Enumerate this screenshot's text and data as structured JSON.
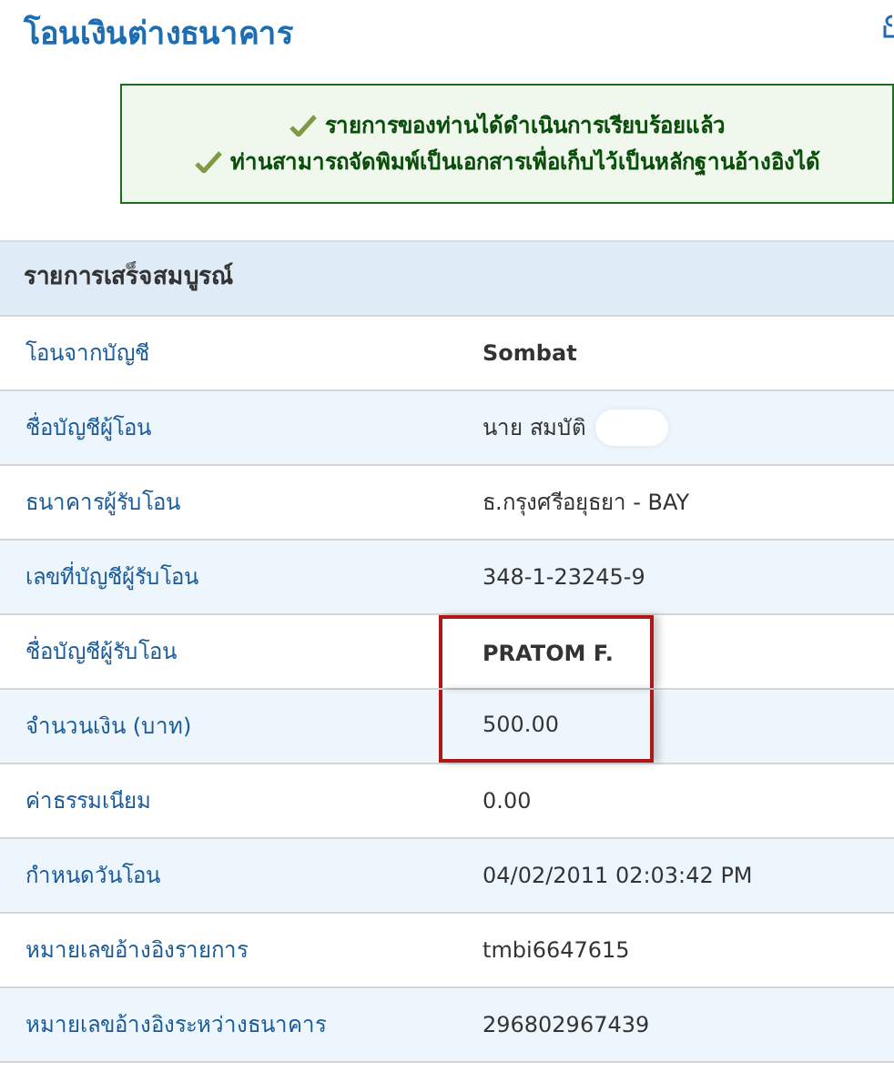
{
  "title": "โอนเงินต่างธนาคาร",
  "notice": [
    "รายการของท่านได้ดำเนินการเรียบร้อยแล้ว",
    "ท่านสามารถจัดพิมพ์เป็นเอกสารเพื่อเก็บไว้เป็นหลักฐานอ้างอิงได้"
  ],
  "section": {
    "title": "รายการเสร็จสมบูรณ์"
  },
  "rows": [
    {
      "label": "โอนจากบัญชี",
      "value": "Sombat",
      "emphasis": true,
      "redacted": false,
      "highlighted": false
    },
    {
      "label": "ชื่อบัญชีผู้โอน",
      "value": "นาย สมบัติ",
      "emphasis": false,
      "redacted": true,
      "highlighted": false
    },
    {
      "label": "ธนาคารผู้รับโอน",
      "value": "ธ.กรุงศรีอยุธยา - BAY",
      "emphasis": false,
      "redacted": false,
      "highlighted": false
    },
    {
      "label": "เลขที่บัญชีผู้รับโอน",
      "value": "348-1-23245-9",
      "emphasis": false,
      "redacted": false,
      "highlighted": false
    },
    {
      "label": "ชื่อบัญชีผู้รับโอน",
      "value": "PRATOM F.",
      "emphasis": true,
      "redacted": false,
      "highlighted": true
    },
    {
      "label": "จำนวนเงิน (บาท)",
      "value": "500.00",
      "emphasis": false,
      "redacted": false,
      "highlighted": true
    },
    {
      "label": "ค่าธรรมเนียม",
      "value": "0.00",
      "emphasis": false,
      "redacted": false,
      "highlighted": false
    },
    {
      "label": "กำหนดวันโอน",
      "value": "04/02/2011 02:03:42 PM",
      "emphasis": false,
      "redacted": false,
      "highlighted": false
    },
    {
      "label": "หมายเลขอ้างอิงรายการ",
      "value": "tmbi6647615",
      "emphasis": false,
      "redacted": false,
      "highlighted": false
    },
    {
      "label": "หมายเลขอ้างอิงระหว่างธนาคาร",
      "value": "296802967439",
      "emphasis": false,
      "redacted": false,
      "highlighted": false
    }
  ]
}
